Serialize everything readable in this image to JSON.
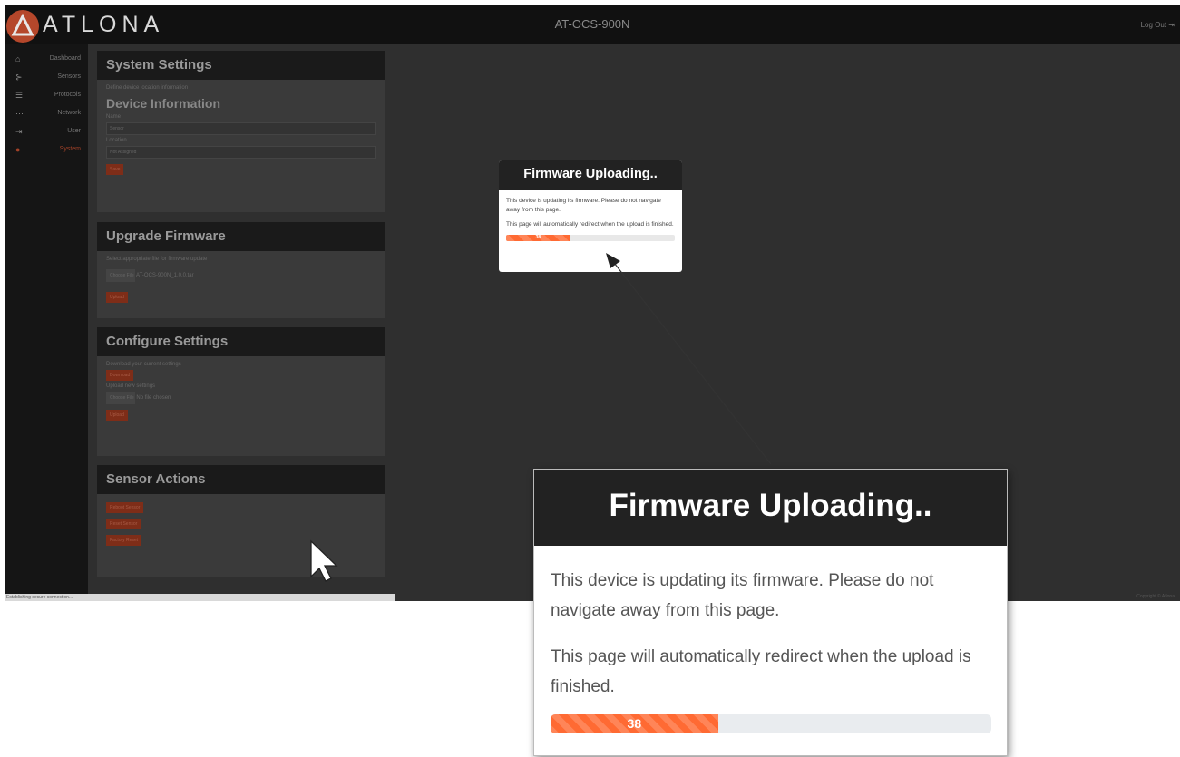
{
  "app": {
    "brand": "ATLONA",
    "device_title": "AT-OCS-900N",
    "logout": "Log Out"
  },
  "sidebar": {
    "items": [
      {
        "label": "Dashboard",
        "icon": "home-icon"
      },
      {
        "label": "Sensors",
        "icon": "sensors-icon"
      },
      {
        "label": "Protocols",
        "icon": "list-icon"
      },
      {
        "label": "Network",
        "icon": "network-icon"
      },
      {
        "label": "User",
        "icon": "user-icon"
      },
      {
        "label": "System",
        "icon": "location-icon"
      }
    ]
  },
  "system_settings": {
    "title": "System Settings",
    "hint": "Define device location information",
    "device_info_heading": "Device Information",
    "name_label": "Name",
    "name_value": "Sensor",
    "location_label": "Location",
    "location_value": "Not Assigned",
    "save_label": "Save"
  },
  "upgrade_firmware": {
    "title": "Upgrade Firmware",
    "hint": "Select appropriate file for firmware update",
    "choose_label": "Choose File",
    "file_name": "AT-OCS-900N_1.0.0.tar",
    "upload_label": "Upload"
  },
  "configure_settings": {
    "title": "Configure Settings",
    "download_hint": "Download your current settings",
    "download_label": "Download",
    "upload_hint": "Upload new settings",
    "choose_label": "Choose File",
    "file_name": "No file chosen",
    "upload_label": "Upload"
  },
  "sensor_actions": {
    "title": "Sensor Actions",
    "actions": [
      "Reboot Sensor",
      "Reset Sensor",
      "Factory Reset"
    ]
  },
  "status_bar": "Establishing secure connection...",
  "copyright": "Copyright © Atlona",
  "dialog": {
    "title": "Firmware Uploading..",
    "message1": "This device is updating its firmware. Please do not navigate away from this page.",
    "message2": "This page will automatically redirect when the upload is finished.",
    "progress_label": "38",
    "progress_percent": 38,
    "progress_color": "#ff6a33"
  }
}
